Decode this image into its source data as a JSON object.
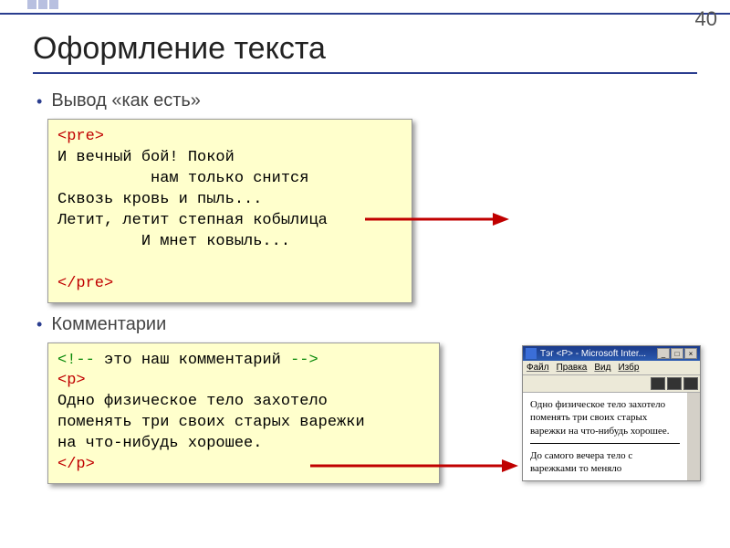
{
  "page_number": "40",
  "heading": "Оформление текста",
  "section1_label": "Вывод «как есть»",
  "section2_label": "Комментарии",
  "code1": {
    "open_tag": "<pre>",
    "body": "И вечный бой! Покой\n          нам только снится\nСквозь кровь и пыль...\nЛетит, летит степная кобылица\n         И мнет ковыль...",
    "close_tag": "</pre>"
  },
  "code2": {
    "comment_open": "<!--",
    "comment_text": " это наш комментарий ",
    "comment_close": "-->",
    "p_open": "<p>",
    "body": "Одно физическое тело захотело\nпоменять три своих старых варежки\nна что-нибудь хорошее.",
    "p_close": "</p>"
  },
  "browser": {
    "title": "Тэг <P> - Microsoft Inter...",
    "menu": {
      "file": "Файл",
      "edit": "Правка",
      "view": "Вид",
      "fav": "Избр"
    },
    "para1": "Одно физическое тело захотело поменять три своих старых варежки на что-нибудь хорошее.",
    "para2": "До самого вечера тело с варежками то меняло"
  },
  "colors": {
    "accent": "#2a3d8f",
    "codebg": "#ffffcc",
    "arrow": "#c00000"
  }
}
